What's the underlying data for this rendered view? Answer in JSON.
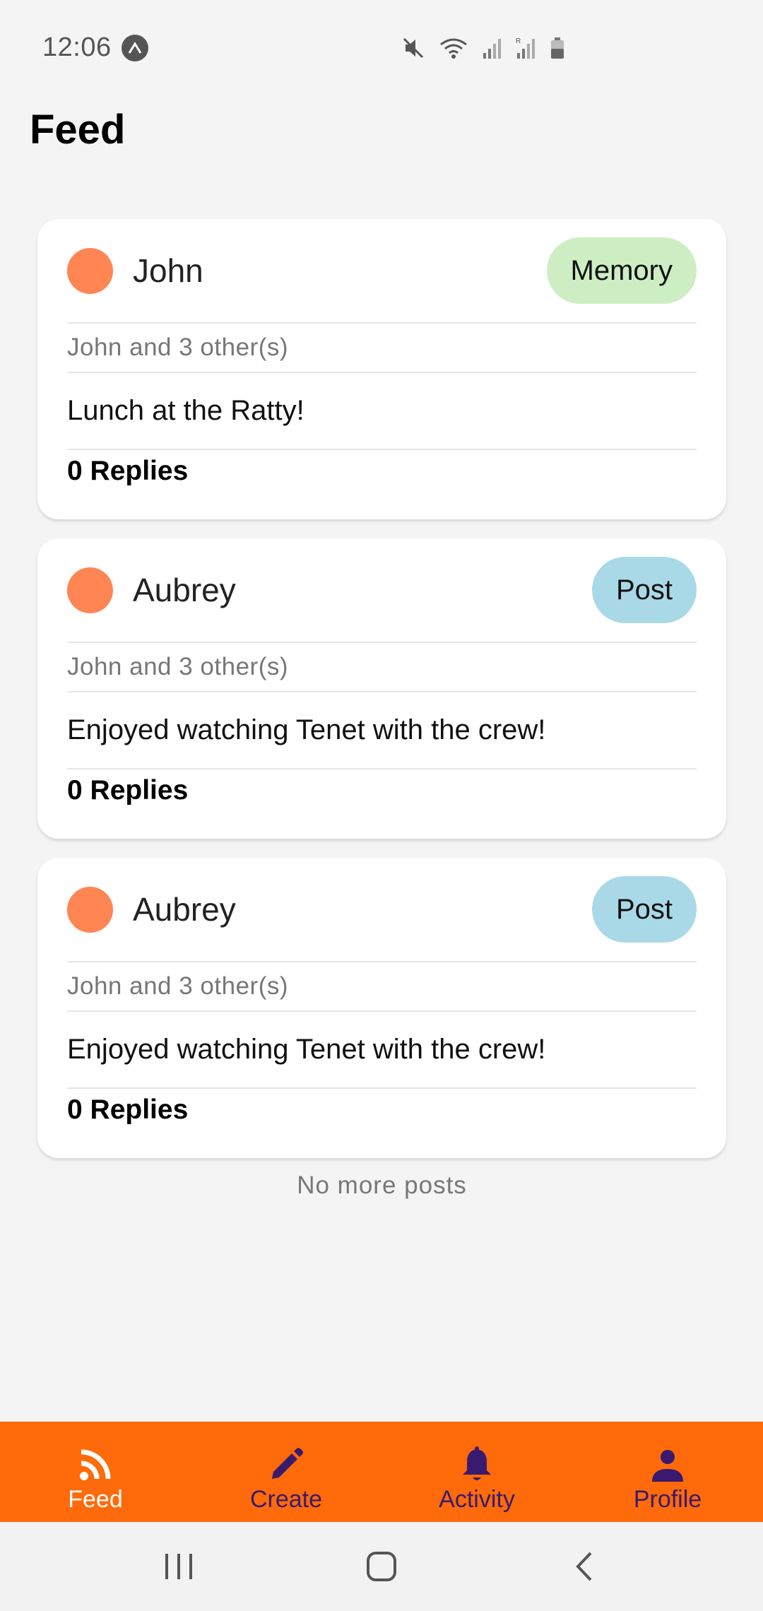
{
  "status_bar": {
    "time": "12:06"
  },
  "page": {
    "title": "Feed"
  },
  "posts": [
    {
      "author": "John",
      "badge": "Memory",
      "participants": "John and 3 other(s)",
      "text": "Lunch at the Ratty!",
      "replies": "0 Replies"
    },
    {
      "author": "Aubrey",
      "badge": "Post",
      "participants": "John and 3 other(s)",
      "text": "Enjoyed watching Tenet with the crew!",
      "replies": "0 Replies"
    },
    {
      "author": "Aubrey",
      "badge": "Post",
      "participants": "John and 3 other(s)",
      "text": "Enjoyed watching Tenet with the crew!",
      "replies": "0 Replies"
    }
  ],
  "feed_footer": "No more posts",
  "tabs": [
    {
      "label": "Feed",
      "icon": "rss-icon",
      "active": true
    },
    {
      "label": "Create",
      "icon": "pencil-icon",
      "active": false
    },
    {
      "label": "Activity",
      "icon": "bell-icon",
      "active": false
    },
    {
      "label": "Profile",
      "icon": "person-icon",
      "active": false
    }
  ],
  "colors": {
    "tab_bar": "#ff6a0a",
    "avatar": "#ff8552",
    "memory_badge": "#cdeec3",
    "post_badge": "#a9d9e6",
    "tab_inactive": "#3a1a6e"
  },
  "system_nav": [
    "recents-icon",
    "home-icon",
    "back-icon"
  ]
}
